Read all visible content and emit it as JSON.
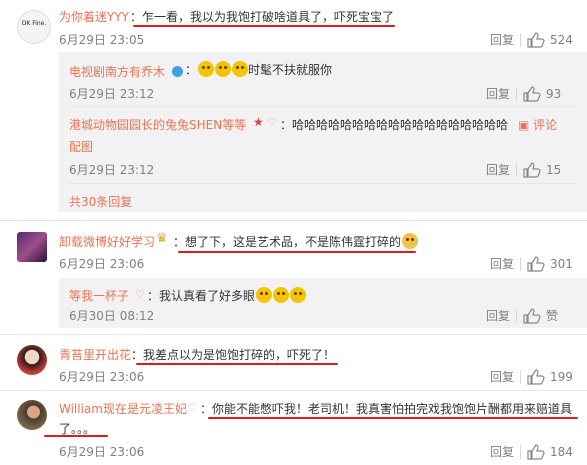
{
  "comments": [
    {
      "avatar_text": "OK Fine.",
      "name": "为你着迷YYY",
      "text": "乍一看，我以为我饱打破啥道具了，吓死宝宝了",
      "time": "6月29日 23:05",
      "reply_label": "回复",
      "likes": "524"
    },
    {
      "name": "卸载微博好好学习",
      "text": "想了下，这是艺术品，不是陈伟霆打碎的",
      "time": "6月29日 23:06",
      "reply_label": "回复",
      "likes": "301"
    },
    {
      "name": "青苔里开出花",
      "text": "我差点以为是饱饱打碎的，吓死了！",
      "time": "6月29日 23:06",
      "reply_label": "回复",
      "likes": "199"
    },
    {
      "name": "William现在是元凌王妃",
      "text_line1": "你能不能憋吓我！老司机！我真害怕拍完戏我饱饱片酬都用来赔道具",
      "text_line2": "了。。。",
      "time": "6月29日 23:06",
      "reply_label": "回复",
      "likes": "184"
    }
  ],
  "replies": [
    {
      "name": "电视剧南方有乔木",
      "text": "时髦不扶就服你",
      "time": "6月29日 23:12",
      "reply_label": "回复",
      "likes": "93"
    },
    {
      "name": "港城动物园园长的兔兔SHEN等等",
      "text": "哈哈哈哈哈哈哈哈哈哈哈哈哈哈哈哈哈哈",
      "extra_label": "评论",
      "extra_label2": "配图",
      "time": "6月29日 23:12",
      "reply_label": "回复",
      "likes": "15"
    },
    {
      "name": "等我一杯子",
      "text": "我认真看了好多眼",
      "time": "6月30日 08:12",
      "reply_label": "回复",
      "likes": "赞"
    }
  ],
  "more_replies": "共30条回复",
  "colors": {
    "name": "#eb7350",
    "underline": "#e41a1a",
    "reply_bg": "#f2f2f5",
    "text": "#333333",
    "muted": "#808080"
  }
}
